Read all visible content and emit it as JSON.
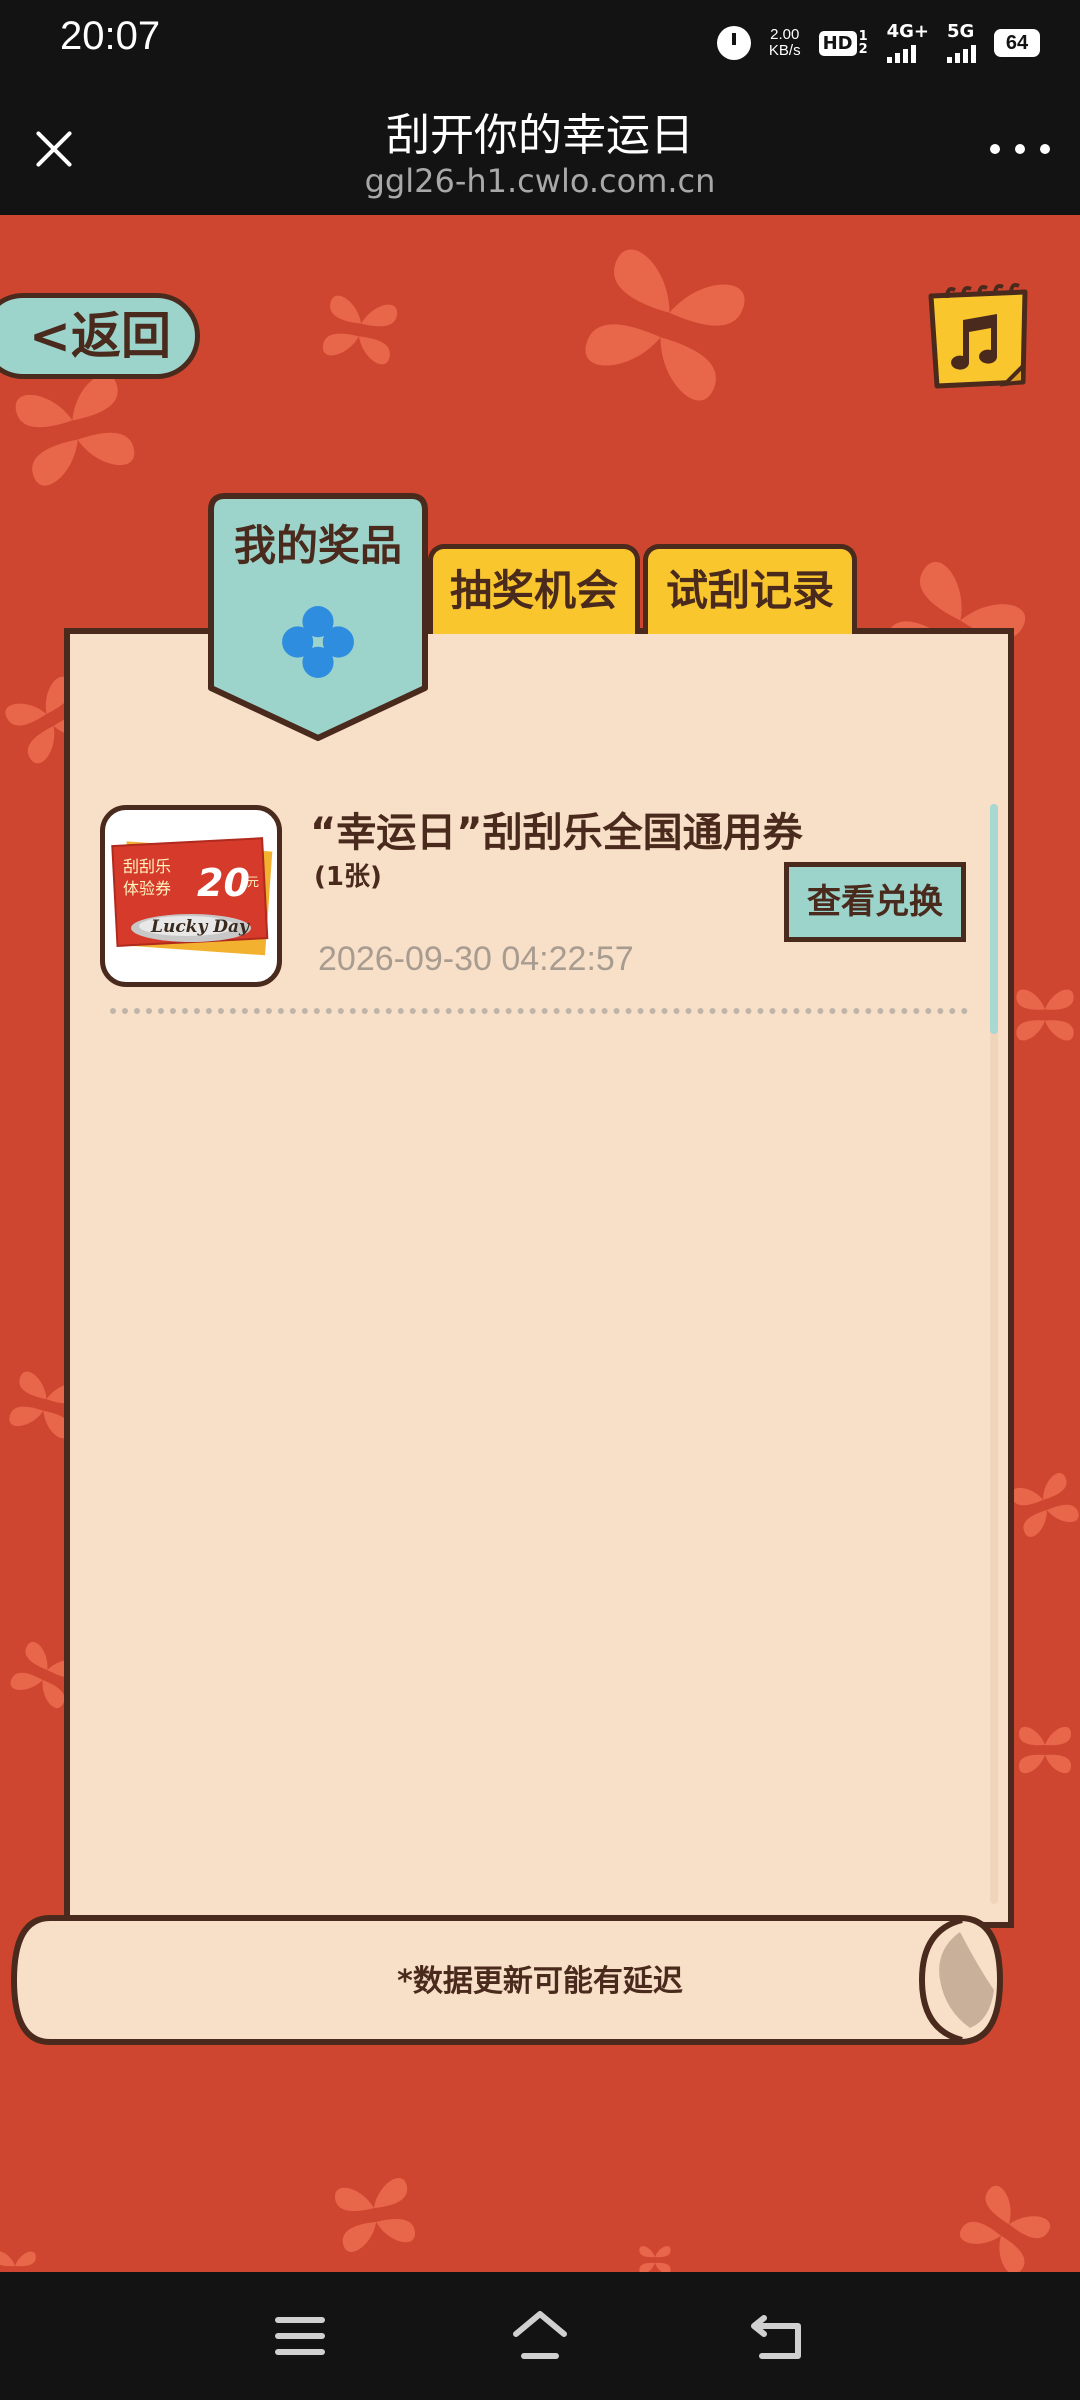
{
  "status_bar": {
    "time": "20:07",
    "speed_value": "2.00",
    "speed_unit": "KB/s",
    "hd_label": "HD",
    "sim_digits": "1 2",
    "network_4g": "4G+",
    "network_5g": "5G",
    "battery": "64"
  },
  "header": {
    "title": "刮开你的幸运日",
    "url": "ggl26-h1.cwlo.com.cn"
  },
  "nav": {
    "back_label": "<返回"
  },
  "tabs": [
    {
      "label": "我的奖品",
      "active": true
    },
    {
      "label": "抽奖机会",
      "active": false
    },
    {
      "label": "试刮记录",
      "active": false
    }
  ],
  "prizes": [
    {
      "name": "“幸运日”刮刮乐全国通用券",
      "count": "(1张)",
      "date": "2026-09-30 04:22:57",
      "action_label": "查看兑换",
      "thumbnail": {
        "line1": "刮刮乐",
        "line2": "体验券",
        "amount": "20",
        "unit": "元",
        "brand": "Lucky Day"
      }
    }
  ],
  "footer_note": "*数据更新可能有延迟",
  "colors": {
    "background": "#cf4630",
    "clover": "#e8664a",
    "panel": "#f8e0c8",
    "teal": "#9cd4cc",
    "yellow": "#f9c62e",
    "outline": "#4a2a1c"
  },
  "icons": {
    "music": "music-note-icon",
    "clover": "clover-icon",
    "close": "close-icon",
    "more": "more-dots-icon"
  }
}
